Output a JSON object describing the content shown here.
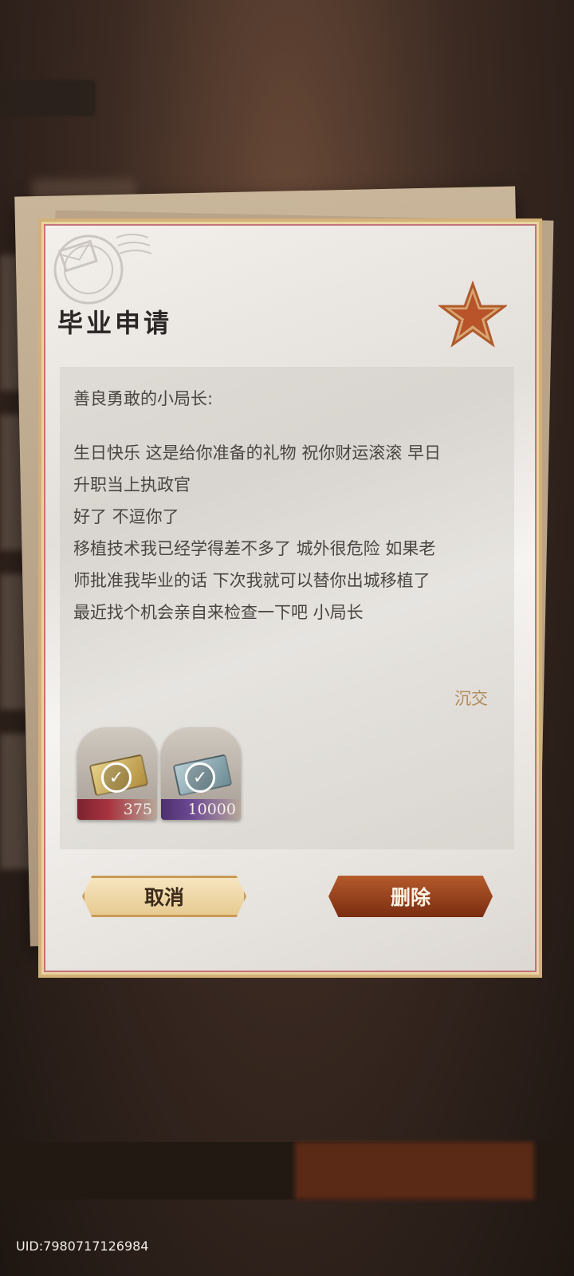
{
  "letter": {
    "title": "毕业申请",
    "greeting": "善良勇敢的小局长:",
    "body_lines": [
      "生日快乐 这是给你准备的礼物 祝你财运滚滚 早日",
      "升职当上执政官",
      "好了 不逗你了",
      "移植技术我已经学得差不多了 城外很危险 如果老",
      "师批准我毕业的话 下次我就可以替你出城移植了",
      "最近找个机会亲自来检查一下吧 小局长"
    ],
    "signature": "沉交"
  },
  "attachments": [
    {
      "quantity": "375",
      "claimed": true,
      "icon": "gold-ticket-icon"
    },
    {
      "quantity": "10000",
      "claimed": true,
      "icon": "silver-ticket-icon"
    }
  ],
  "buttons": {
    "cancel_label": "取消",
    "delete_label": "删除"
  },
  "footer": {
    "uid": "UID:7980717126984"
  },
  "colors": {
    "cancel_button": "#e6c98f",
    "delete_button": "#7a2d10",
    "signature": "#b08a5e"
  }
}
